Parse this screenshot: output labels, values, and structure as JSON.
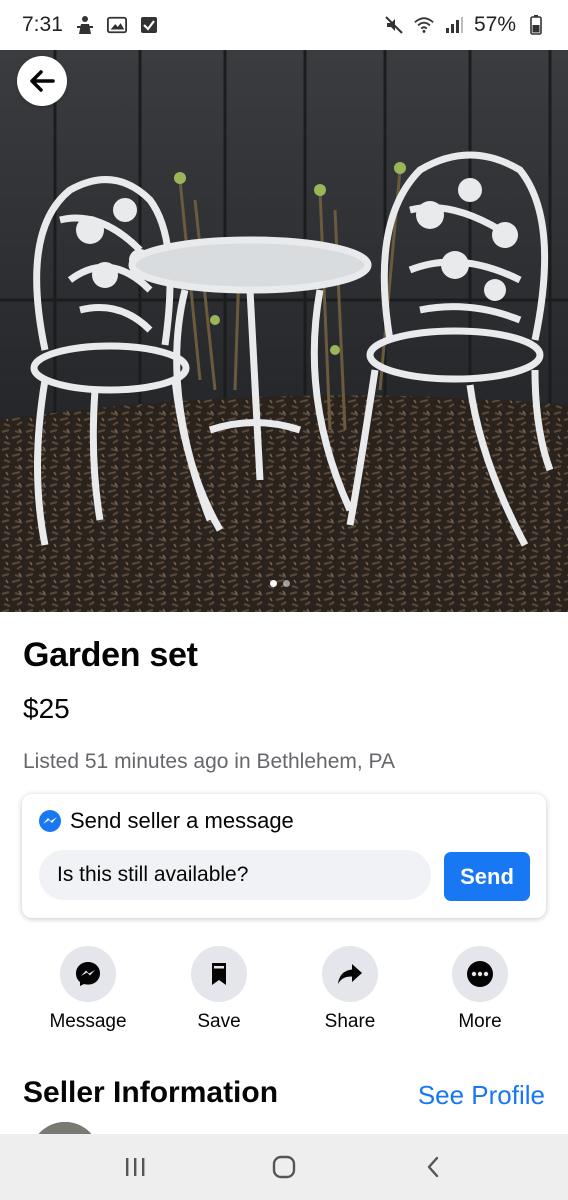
{
  "status_bar": {
    "time": "7:31",
    "battery": "57%",
    "left_icons": [
      "person-notification-icon",
      "image-notification-icon",
      "checkbox-notification-icon"
    ],
    "right_icons": [
      "mute-icon",
      "wifi-icon",
      "signal-icon",
      "battery-icon"
    ]
  },
  "hero": {
    "image": "white cast-iron bistro set: two chairs and a round table on mulch",
    "carousel_count": 2,
    "carousel_active": 0
  },
  "listing": {
    "title": "Garden set",
    "price": "$25",
    "listed": "Listed 51 minutes ago in Bethlehem, PA"
  },
  "message_card": {
    "heading": "Send seller a message",
    "input_value": "Is this still available?",
    "send_label": "Send"
  },
  "actions": [
    {
      "label": "Message",
      "icon": "messenger-icon"
    },
    {
      "label": "Save",
      "icon": "bookmark-icon"
    },
    {
      "label": "Share",
      "icon": "share-arrow-icon"
    },
    {
      "label": "More",
      "icon": "more-dots-icon"
    }
  ],
  "seller": {
    "title": "Seller Information",
    "link": "See Profile"
  },
  "colors": {
    "accent": "#1877f2",
    "secondary_text": "#65676b",
    "action_bg": "#e4e6eb"
  }
}
